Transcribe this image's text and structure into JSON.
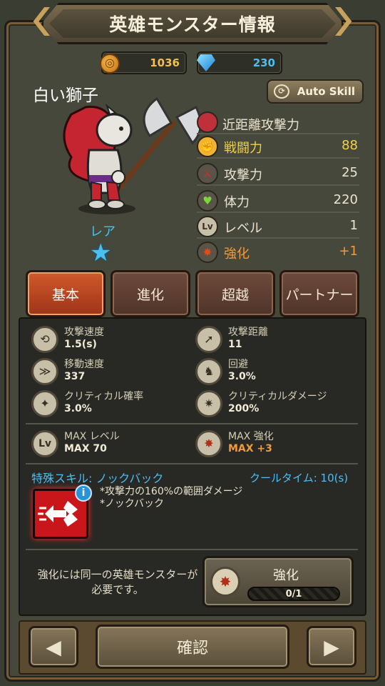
{
  "header": {
    "title": "英雄モンスター情報"
  },
  "currency": {
    "gold": "1036",
    "gems": "230"
  },
  "monster": {
    "name": "白い獅子",
    "rarity": "レア",
    "auto_skill_label": "Auto Skill"
  },
  "stats": {
    "type_label": "近距離攻撃力",
    "power_label": "戦闘力",
    "power_value": "88",
    "attack_label": "攻撃力",
    "attack_value": "25",
    "hp_label": "体力",
    "hp_value": "220",
    "level_label": "レベル",
    "level_value": "1",
    "enhance_label": "強化",
    "enhance_value": "+1"
  },
  "tabs": [
    "基本",
    "進化",
    "超越",
    "パートナー"
  ],
  "attributes": {
    "attack_speed": {
      "label": "攻撃速度",
      "value": "1.5(s)"
    },
    "attack_range": {
      "label": "攻撃距離",
      "value": "11"
    },
    "move_speed": {
      "label": "移動速度",
      "value": "337"
    },
    "evasion": {
      "label": "回避",
      "value": "3.0%"
    },
    "crit_rate": {
      "label": "クリティカル確率",
      "value": "3.0%"
    },
    "crit_damage": {
      "label": "クリティカルダメージ",
      "value": "200%"
    },
    "max_level": {
      "label": "MAX レベル",
      "value": "MAX 70"
    },
    "max_enhance": {
      "label": "MAX 強化",
      "value": "MAX +3"
    }
  },
  "skill": {
    "title": "特殊スキル: ノックバック",
    "cooldown": "クールタイム: 10(s)",
    "desc_line1": "*攻撃力の160%の範囲ダメージ",
    "desc_line2": "*ノックバック"
  },
  "upgrade": {
    "requirement": "強化には同一の英雄モンスターが必要です。",
    "button_label": "強化",
    "progress_text": "0/1",
    "progress_fraction": 0
  },
  "footer": {
    "confirm_label": "確認"
  },
  "colors": {
    "accent_orange": "#f19a38",
    "accent_blue": "#4dbef0",
    "tab_active": "#c8502a"
  }
}
